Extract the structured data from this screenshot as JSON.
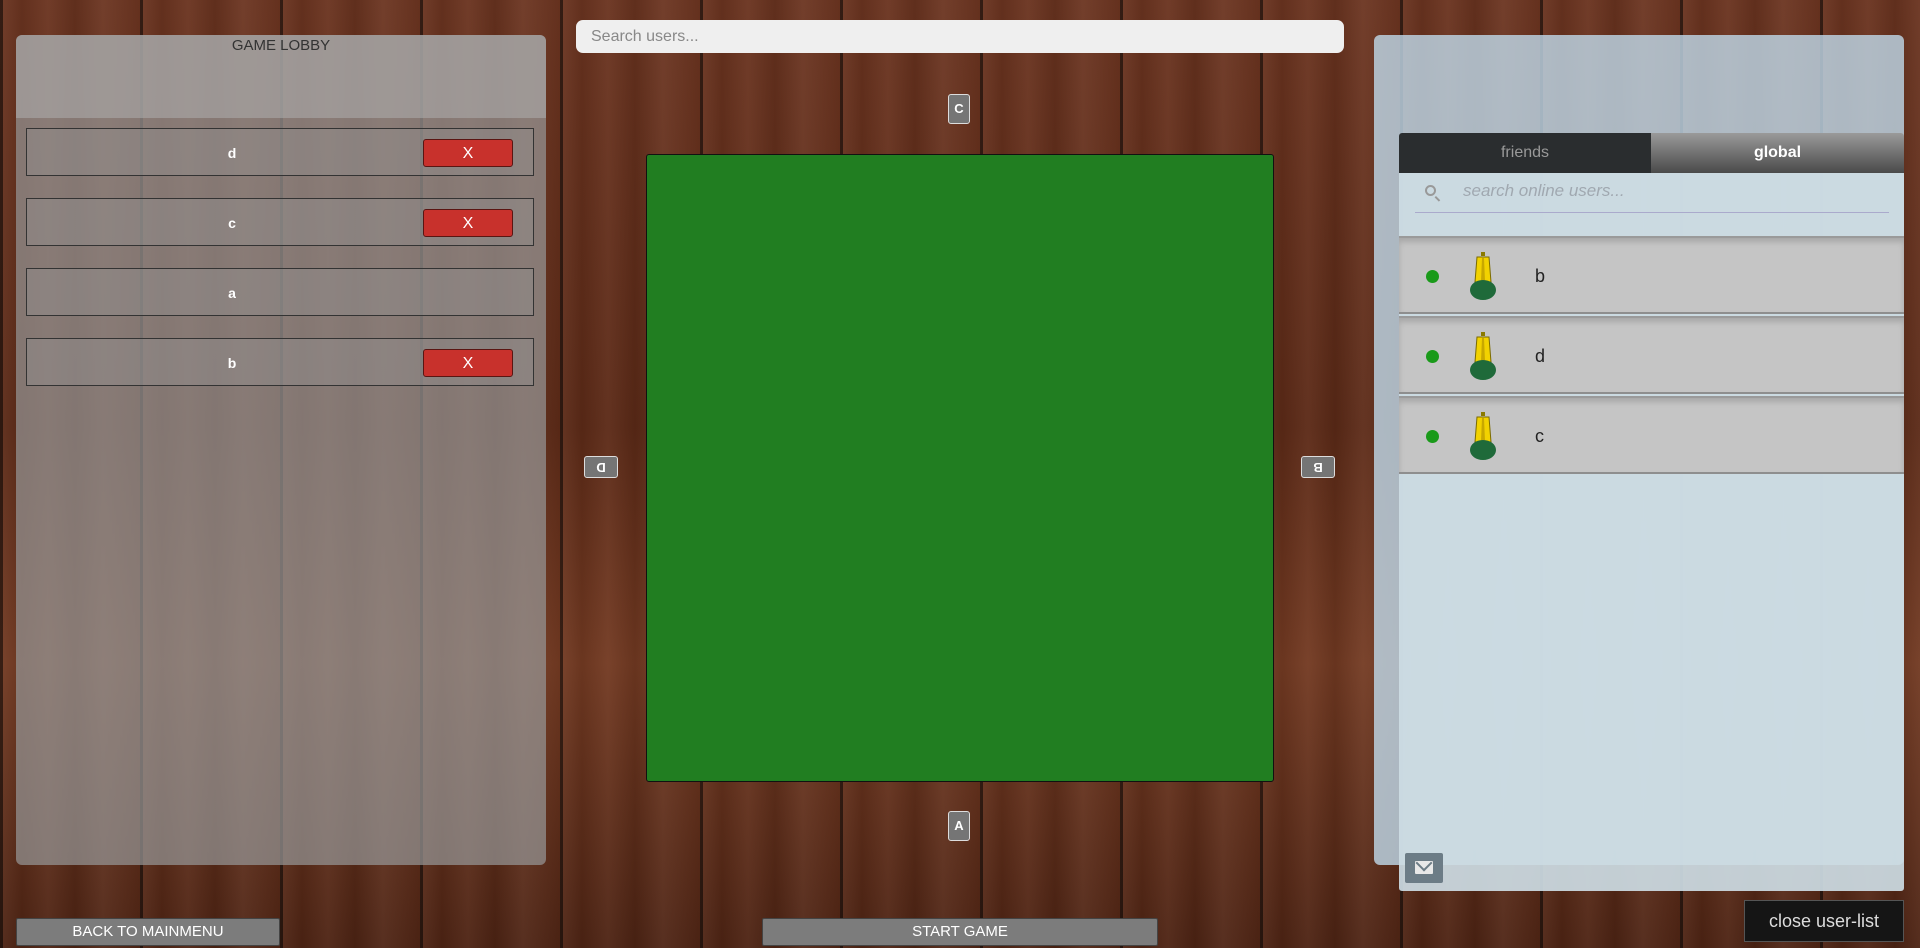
{
  "lobby": {
    "title": "GAME LOBBY",
    "players": [
      {
        "name": "d",
        "kick_label": "X",
        "kickable": true
      },
      {
        "name": "c",
        "kick_label": "X",
        "kickable": true
      },
      {
        "name": "a",
        "kick_label": "",
        "kickable": false
      },
      {
        "name": "b",
        "kick_label": "X",
        "kickable": true
      }
    ]
  },
  "top_search": {
    "placeholder": "Search users..."
  },
  "table": {
    "color": "#217e21",
    "seats": {
      "top": "C",
      "right": "B",
      "bottom": "A",
      "left": "D"
    }
  },
  "buttons": {
    "back": "BACK TO MAINMENU",
    "start": "START GAME",
    "close_userlist": "close user-list"
  },
  "userlist": {
    "tabs": {
      "friends": "friends",
      "global": "global",
      "active": "global"
    },
    "search_placeholder": "search online users...",
    "users": [
      {
        "name": "b",
        "status": "online",
        "icon": "pawn-icon"
      },
      {
        "name": "d",
        "status": "online",
        "icon": "pawn-icon"
      },
      {
        "name": "c",
        "status": "online",
        "icon": "pawn-icon"
      }
    ],
    "mail_icon": "mail-icon"
  }
}
